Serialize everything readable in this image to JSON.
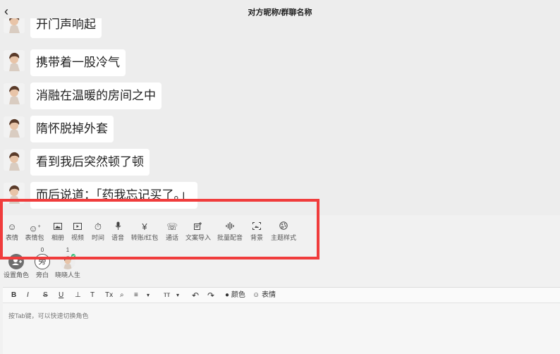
{
  "header": {
    "title": "对方昵称/群聊名称",
    "back_icon": "chevron-left-icon"
  },
  "messages": [
    {
      "text": "开门声响起"
    },
    {
      "text": "携带着一股冷气"
    },
    {
      "text": "消融在温暖的房间之中"
    },
    {
      "text": "隋怀脱掉外套"
    },
    {
      "text": "看到我后突然顿了顿"
    },
    {
      "text": "而后说道：「药我忘记买了。」"
    }
  ],
  "toolbar": [
    {
      "label": "表情",
      "icon": "smile-icon"
    },
    {
      "label": "表情包",
      "icon": "sticker-icon"
    },
    {
      "label": "相册",
      "icon": "image-icon"
    },
    {
      "label": "视频",
      "icon": "video-icon"
    },
    {
      "label": "时间",
      "icon": "timer-icon"
    },
    {
      "label": "语音",
      "icon": "mic-icon"
    },
    {
      "label": "转账/红包",
      "icon": "yen-icon"
    },
    {
      "label": "通话",
      "icon": "phone-icon"
    },
    {
      "label": "文案导入",
      "icon": "import-icon"
    },
    {
      "label": "批量配音",
      "icon": "waveform-icon"
    },
    {
      "label": "背景",
      "icon": "background-icon"
    },
    {
      "label": "主题样式",
      "icon": "palette-icon"
    }
  ],
  "roles": [
    {
      "label": "设置角色",
      "count": "",
      "icon": "add-user-icon"
    },
    {
      "label": "旁白",
      "count": "0",
      "badge": "旁"
    },
    {
      "label": "晓晓人生",
      "count": "1",
      "icon": "avatar-icon"
    }
  ],
  "editor": {
    "color_label": "颜色",
    "emoji_label": "表情",
    "placeholder": "按Tab键，可以快速切换角色",
    "format_buttons": [
      "B",
      "I",
      "S",
      "U",
      "⊥",
      "T",
      "Tx",
      "⌕",
      "≡",
      "▾",
      "тт",
      "▾",
      "↶",
      "↷"
    ]
  },
  "colors": {
    "highlight_border": "#f03c3c",
    "background": "#ededed",
    "bubble": "#ffffff"
  }
}
